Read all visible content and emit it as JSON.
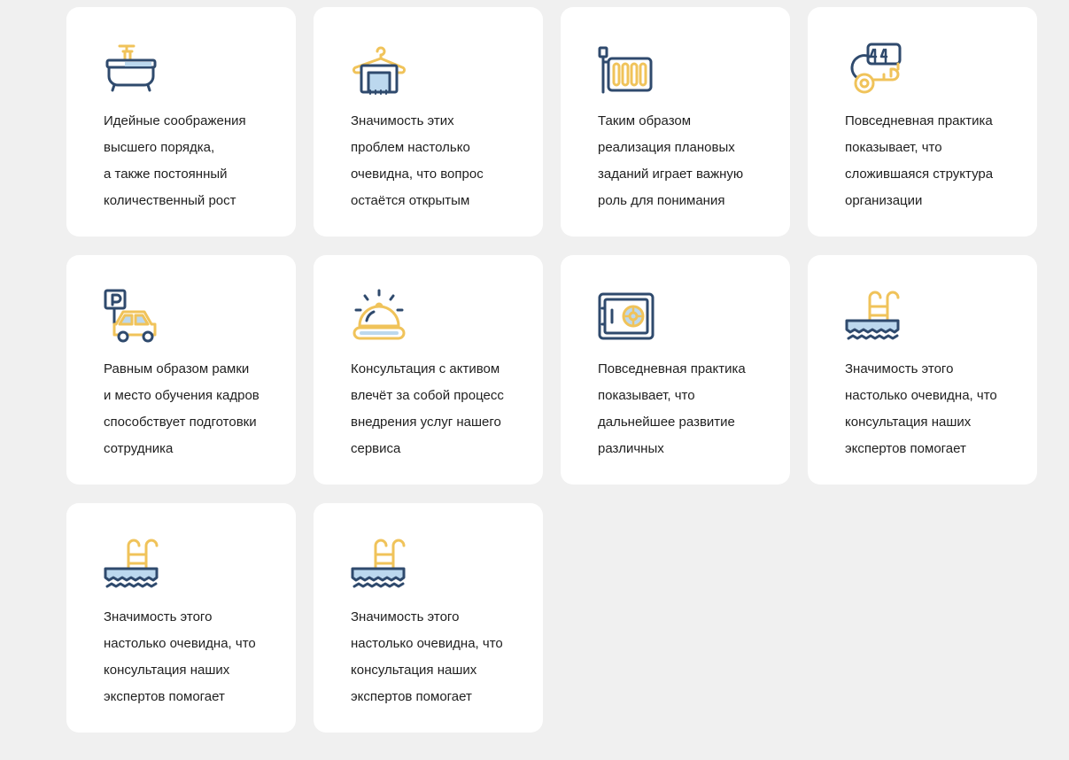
{
  "colors": {
    "background": "#f0f0f0",
    "card": "#ffffff",
    "icon_dark": "#2f4a6d",
    "icon_accent": "#f0c35a",
    "icon_light": "#bcd8ee",
    "text": "#1f1f1f"
  },
  "features": [
    {
      "icon": "bathtub-icon",
      "text": "Идейные соображения\nвысшего порядка,\nа также постоянный\nколичественный рост"
    },
    {
      "icon": "towel-hanger-icon",
      "text": "Значимость этих\nпроблем настолько\nочевидна, что вопрос\nостаётся открытым"
    },
    {
      "icon": "radiator-icon",
      "text": "Таким образом\nреализация плановых\nзаданий играет важную\nроль для понимания"
    },
    {
      "icon": "room-key-icon",
      "text": "Повседневная практика\nпоказывает, что\nсложившаяся структура\nорганизации"
    },
    {
      "icon": "parking-car-icon",
      "text": "Равным образом рамки\nи место обучения кадров\nспособствует подготовки\nсотрудника"
    },
    {
      "icon": "service-bell-icon",
      "text": "Консультация с активом\nвлечёт за собой процесс\nвнедрения услуг нашего\nсервиса"
    },
    {
      "icon": "safe-icon",
      "text": "Повседневная практика\nпоказывает, что\nдальнейшее развитие\nразличных"
    },
    {
      "icon": "pool-icon",
      "text": "Значимость этого\nнастолько очевидна, что\nконсультация наших\nэкспертов помогает"
    },
    {
      "icon": "pool-icon",
      "text": "Значимость этого\nнастолько очевидна, что\nконсультация наших\nэкспертов помогает"
    },
    {
      "icon": "pool-icon",
      "text": "Значимость этого\nнастолько очевидна, что\nконсультация наших\nэкспертов помогает"
    }
  ]
}
